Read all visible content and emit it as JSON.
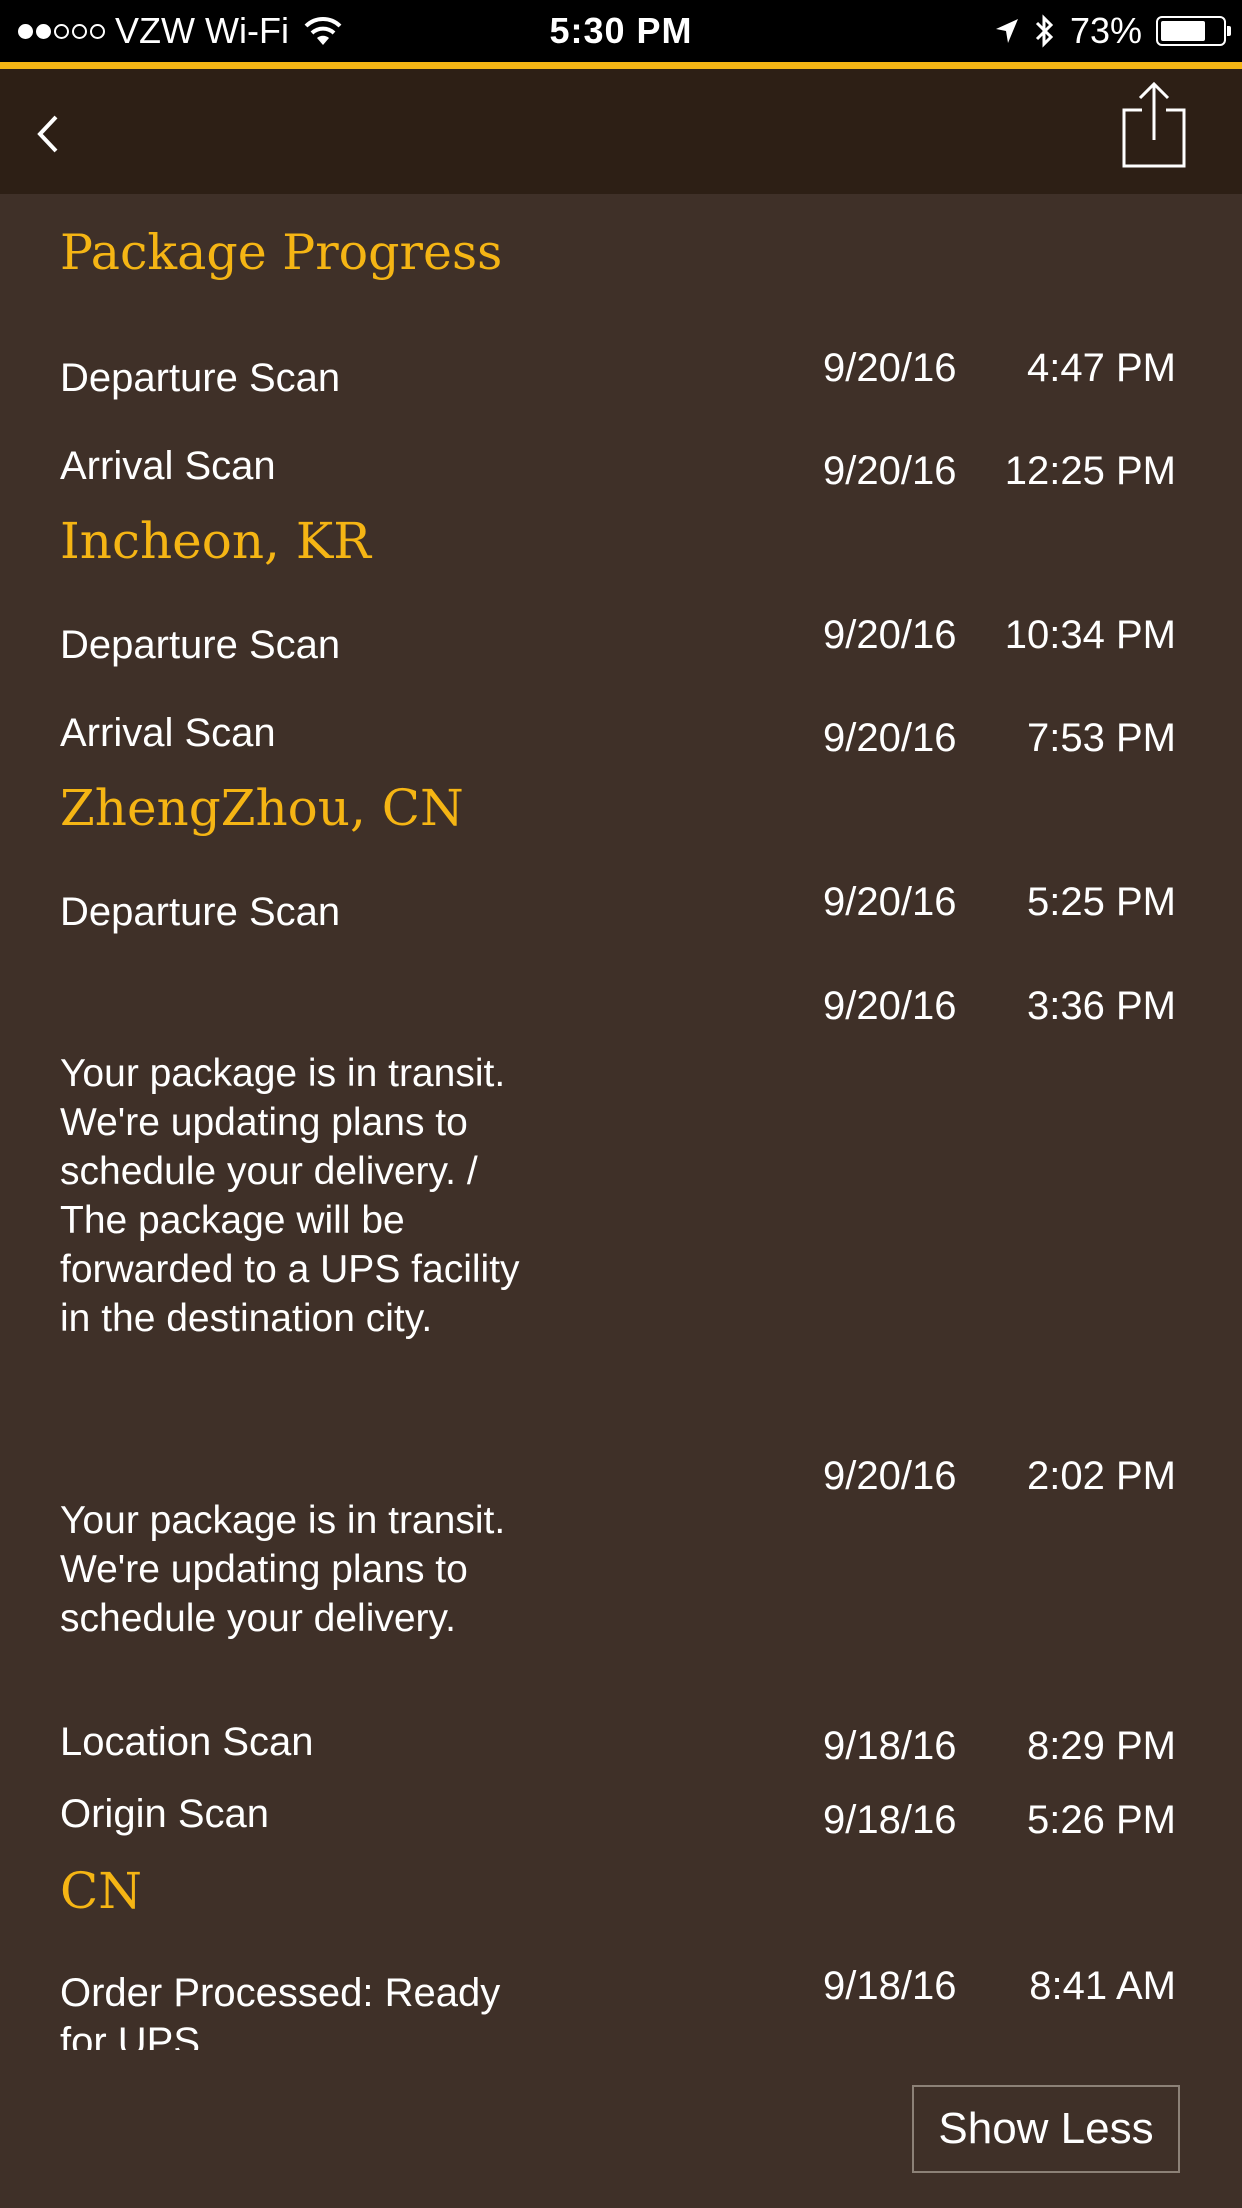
{
  "status_bar": {
    "carrier": "VZW Wi-Fi",
    "time": "5:30 PM",
    "battery": "73%",
    "battery_level": 0.73,
    "signal_icon": "signal-dots-icon",
    "wifi_icon": "wifi-icon",
    "location_icon": "location-arrow-icon",
    "bluetooth_icon": "bluetooth-icon"
  },
  "colors": {
    "accent": "#f5b514",
    "background": "#3f3028",
    "nav_background": "#2d1f15"
  },
  "nav": {
    "back_icon": "chevron-left-icon",
    "share_icon": "share-icon"
  },
  "title": "Package Progress",
  "events": [
    {
      "label": "Departure Scan",
      "date": "9/20/16",
      "time": "4:47 PM"
    },
    {
      "label": "Arrival Scan",
      "date": "9/20/16",
      "time": "12:25 PM"
    },
    {
      "location": "Incheon, KR"
    },
    {
      "label": "Departure Scan",
      "date": "9/20/16",
      "time": "10:34 PM"
    },
    {
      "label": "Arrival Scan",
      "date": "9/20/16",
      "time": "7:53 PM"
    },
    {
      "location": "ZhengZhou, CN"
    },
    {
      "label": "Departure Scan",
      "date": "9/20/16",
      "time": "5:25 PM"
    },
    {
      "date": "9/20/16",
      "time": "3:36 PM",
      "description": [
        "Your package is in transit.",
        "We're updating plans to",
        "schedule your delivery.  /",
        "The package will be",
        "forwarded to a UPS facility",
        "in the destination city."
      ]
    },
    {
      "date": "9/20/16",
      "time": "2:02 PM",
      "description": [
        "Your package is in transit.",
        "We're updating plans to",
        "schedule your delivery."
      ]
    },
    {
      "label": "Location Scan",
      "date": "9/18/16",
      "time": "8:29 PM"
    },
    {
      "label": "Origin Scan",
      "date": "9/18/16",
      "time": "5:26 PM"
    },
    {
      "location": "CN"
    },
    {
      "label": "Order Processed: Ready",
      "label_cont": "for UPS",
      "date": "9/18/16",
      "time": "8:41 AM"
    }
  ],
  "show_less_label": "Show Less"
}
